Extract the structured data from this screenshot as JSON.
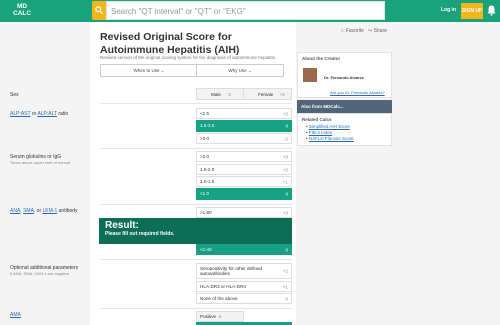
{
  "header": {
    "logo_line1": "MD",
    "logo_line2": "CALC",
    "search_placeholder": "Search \"QT interval\" or \"QT\" or \"EKG\"",
    "login": "Log in",
    "signup": "SIGN UP",
    "brand_color": "#1aa27a",
    "accent_color": "#f2b51b"
  },
  "calc": {
    "title": "Revised Original Score for Autoimmune Hepatitis (AIH)",
    "subtitle": "Revised version of the original scoring system for the diagnosis of autoimmune hepatitis.",
    "tab_when": "When to Use",
    "tab_why": "Why Use",
    "favorite": "Favorite",
    "share": "Share"
  },
  "rows": {
    "sex": {
      "label": "Sex",
      "male": "Male",
      "male_pts": "0",
      "female": "Female",
      "female_pts": "+2"
    },
    "ratio": {
      "label_a": "ALP:AST",
      "label_or": " or ",
      "label_b": "ALP:ALT",
      "label_c": " ratio",
      "opts": [
        {
          "label": "<1.5",
          "pts": "+2"
        },
        {
          "label": "1.5-3.0",
          "pts": "0"
        },
        {
          "label": ">3.0",
          "pts": "-2"
        }
      ]
    },
    "globulins": {
      "label": "Serum globulins or IgG",
      "note": "Times above upper limit of normal",
      "opts": [
        {
          "label": ">2.0",
          "pts": "+3"
        },
        {
          "label": "1.5-2.0",
          "pts": "+2"
        },
        {
          "label": "1.0-1.5",
          "pts": "+1"
        },
        {
          "label": "<1.0",
          "pts": "0"
        }
      ]
    },
    "antibody": {
      "label_a": "ANA",
      "sep1": ", ",
      "label_b": "SMA",
      "sep2": ", or ",
      "label_c": "LKM-1",
      "label_d": " antibody",
      "opts": [
        {
          "label": ">1:80",
          "pts": "+3"
        },
        {
          "label": "<1:40",
          "pts": "0"
        }
      ]
    },
    "params": {
      "label": "Optional additional parameters",
      "note": "If ANA, SMA, LKM-1 are negative",
      "opts": [
        {
          "label": "Seropositivity for other defined autoantibodies",
          "pts": "+2"
        },
        {
          "label": "HLA-DR3 or HLA-DR4",
          "pts": "+1"
        },
        {
          "label": "None of the above",
          "pts": "0"
        }
      ]
    },
    "ama": {
      "label": "AMA",
      "positive": "Positive",
      "positive_pts": "-4"
    }
  },
  "result": {
    "title": "Result:",
    "message": "Please fill out required fields."
  },
  "sidebar": {
    "creator_heading": "About the Creator",
    "creator_name": "Dr. Fernando Alvarez",
    "creator_link": "Are you Dr. Fernando Alvarez?",
    "also_heading": "Also from MDCalc...",
    "related_heading": "Related Calcs",
    "related": [
      "Simplified AIH Score",
      "FIB-4 Index",
      "NAFLD Fibrosis Score"
    ]
  }
}
